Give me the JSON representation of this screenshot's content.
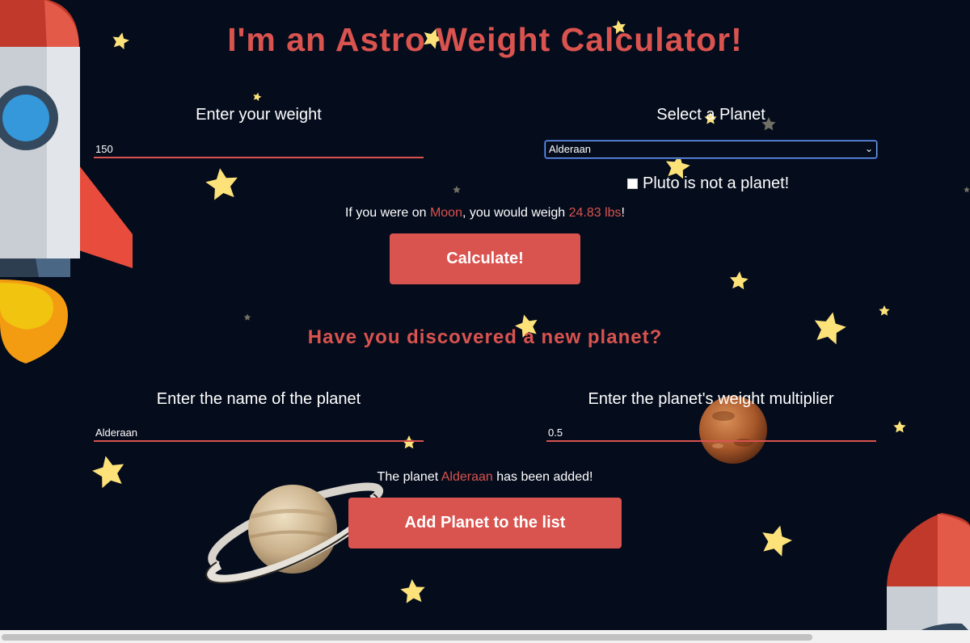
{
  "title": "I'm an Astro Weight Calculator!",
  "weight": {
    "label": "Enter your weight",
    "value": "150"
  },
  "planet_select": {
    "label": "Select a Planet",
    "selected": "Alderaan"
  },
  "pluto": {
    "label": "Pluto is not a planet!",
    "checked": false
  },
  "result": {
    "prefix": "If you were on ",
    "planet": "Moon",
    "middle": ", you would weigh ",
    "weight": "24.83 lbs",
    "suffix": "!"
  },
  "calculate_label": "Calculate!",
  "new_planet": {
    "heading": "Have you discovered a new planet?",
    "name_label": "Enter the name of the planet",
    "name_value": "Alderaan",
    "multiplier_label": "Enter the planet's weight multiplier",
    "multiplier_value": "0.5",
    "added_prefix": "The planet ",
    "added_name": "Alderaan",
    "added_suffix": " has been added!",
    "add_label": "Add Planet to the list"
  },
  "colors": {
    "background": "#050c1c",
    "accent": "#d9534f",
    "star": "#fde27a"
  }
}
